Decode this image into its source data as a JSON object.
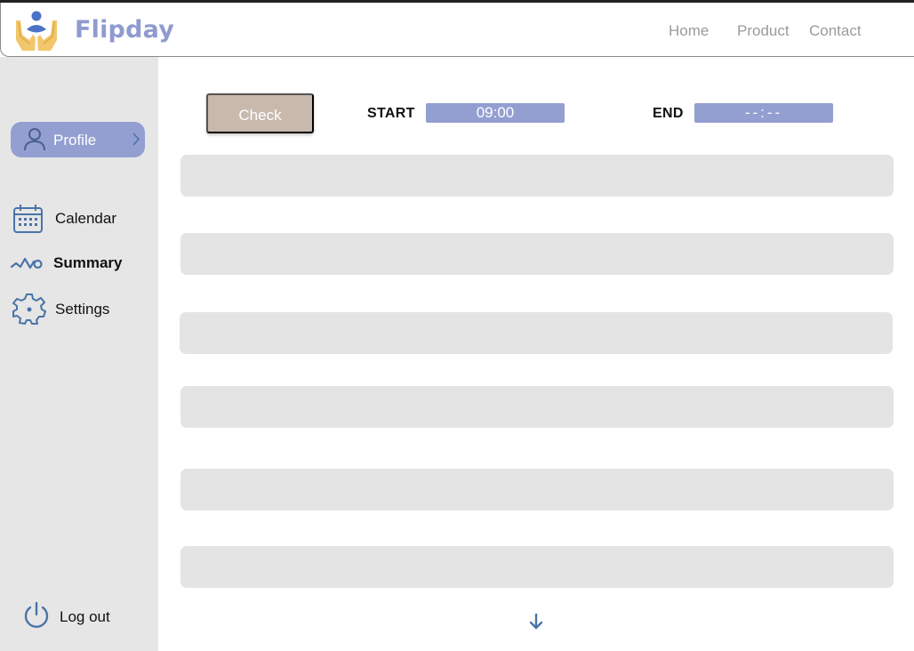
{
  "app": {
    "brand": "Flipday",
    "colors": {
      "brand": "#8f9bd0",
      "accent": "#939fd1",
      "check_button": "#c9b9ad",
      "sidebar_bg": "#e6e6e6",
      "row_bg": "#e4e4e4",
      "icon": "#4a73a8"
    }
  },
  "header": {
    "logo_icon": "hands-holding-person-logo",
    "nav": [
      {
        "label": "Home"
      },
      {
        "label": "Product"
      },
      {
        "label": "Contact"
      }
    ]
  },
  "sidebar": {
    "profile": {
      "label": "Profile",
      "icon": "user-icon",
      "chevron": "chevron-right-icon"
    },
    "items": [
      {
        "label": "Calendar",
        "icon": "calendar-icon"
      },
      {
        "label": "Summary",
        "icon": "activity-wave-icon"
      },
      {
        "label": "Settings",
        "icon": "gear-icon"
      }
    ],
    "logout": {
      "label": "Log out",
      "icon": "power-icon"
    }
  },
  "time_bar": {
    "check_label": "Check",
    "start_label": "START",
    "start_value": "09:00",
    "end_label": "END",
    "end_placeholder": "--:--"
  },
  "rows": [
    {
      "content": ""
    },
    {
      "content": ""
    },
    {
      "content": ""
    },
    {
      "content": ""
    },
    {
      "content": ""
    },
    {
      "content": ""
    }
  ],
  "scroll": {
    "icon": "arrow-down-icon"
  }
}
